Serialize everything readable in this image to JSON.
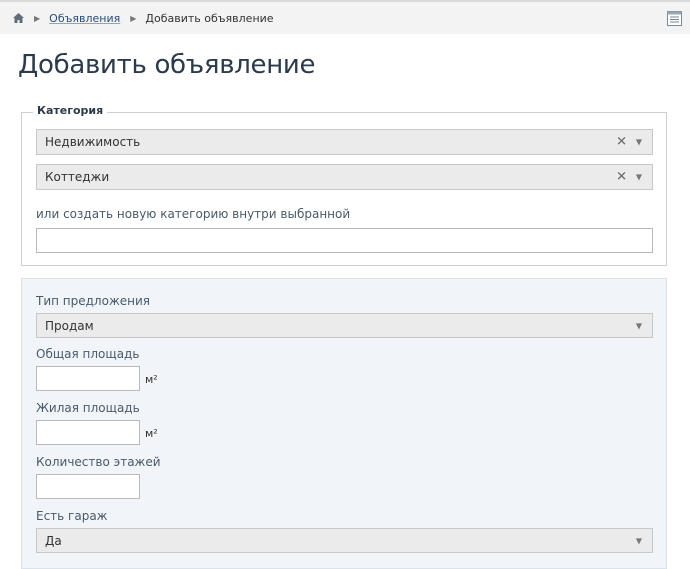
{
  "breadcrumb": {
    "items": [
      "Объявления",
      "Добавить объявление"
    ]
  },
  "page_title": "Добавить объявление",
  "category": {
    "legend": "Категория",
    "select1_value": "Недвижимость",
    "select2_value": "Коттеджи",
    "new_category_label": "или создать новую категорию внутри выбранной",
    "new_category_value": ""
  },
  "details": {
    "offer_type_label": "Тип предложения",
    "offer_type_value": "Продам",
    "total_area_label": "Общая площадь",
    "total_area_unit": "м²",
    "living_area_label": "Жилая площадь",
    "living_area_unit": "м²",
    "floors_label": "Количество этажей",
    "garage_label": "Есть гараж",
    "garage_value": "Да"
  },
  "icons": {
    "home": "home-icon",
    "grid": "grid-icon",
    "clear": "✕",
    "arrow": "▼"
  },
  "colors": {
    "title": "#2b3b4c",
    "link": "#2a4d7a",
    "panel_bg": "#f1f5fa",
    "select_bg": "#ebebeb"
  }
}
